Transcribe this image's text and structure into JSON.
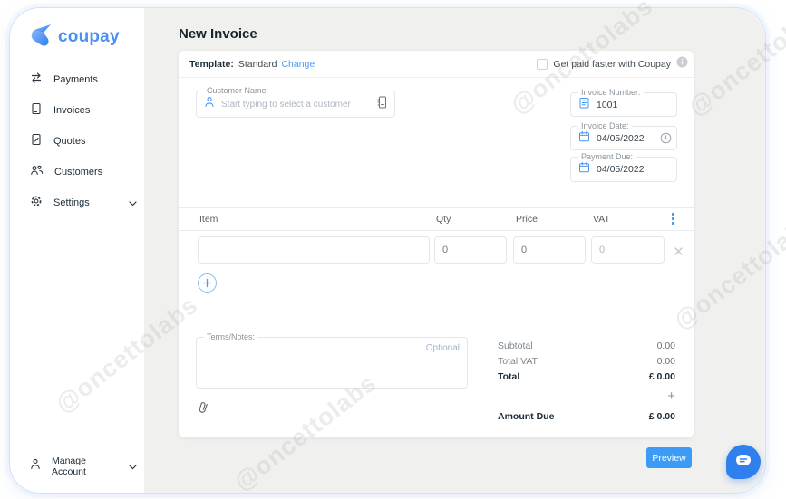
{
  "brand": {
    "name": "coupay"
  },
  "page": {
    "title": "New Invoice"
  },
  "sidebar": {
    "items": [
      {
        "label": "Payments"
      },
      {
        "label": "Invoices"
      },
      {
        "label": "Quotes"
      },
      {
        "label": "Customers"
      },
      {
        "label": "Settings"
      }
    ],
    "manage_account_label": "Manage Account"
  },
  "template_bar": {
    "label": "Template:",
    "value": "Standard",
    "change_label": "Change",
    "promo_label": "Get paid faster with Coupay"
  },
  "customer": {
    "label": "Customer Name:",
    "placeholder": "Start typing to select a customer"
  },
  "meta": {
    "invoice_number_label": "Invoice Number:",
    "invoice_number": "1001",
    "invoice_date_label": "Invoice Date:",
    "invoice_date": "04/05/2022",
    "payment_due_label": "Payment Due:",
    "payment_due": "04/05/2022"
  },
  "items": {
    "headers": [
      "Item",
      "Qty",
      "Price",
      "VAT"
    ],
    "rows": [
      {
        "item": "",
        "qty": "0",
        "price": "0",
        "vat": "0"
      }
    ]
  },
  "notes": {
    "label": "Terms/Notes:",
    "optional_label": "Optional"
  },
  "totals": {
    "subtotal_label": "Subtotal",
    "subtotal": "0.00",
    "total_vat_label": "Total VAT",
    "total_vat": "0.00",
    "total_label": "Total",
    "total": "£ 0.00",
    "plus": "+",
    "amount_due_label": "Amount Due",
    "amount_due": "£ 0.00"
  },
  "actions": {
    "preview_label": "Preview"
  },
  "watermark": {
    "text": "@oncettolabs"
  },
  "colors": {
    "accent": "#4a97f2",
    "button": "#3d9bf5",
    "chat": "#2f80ed"
  }
}
